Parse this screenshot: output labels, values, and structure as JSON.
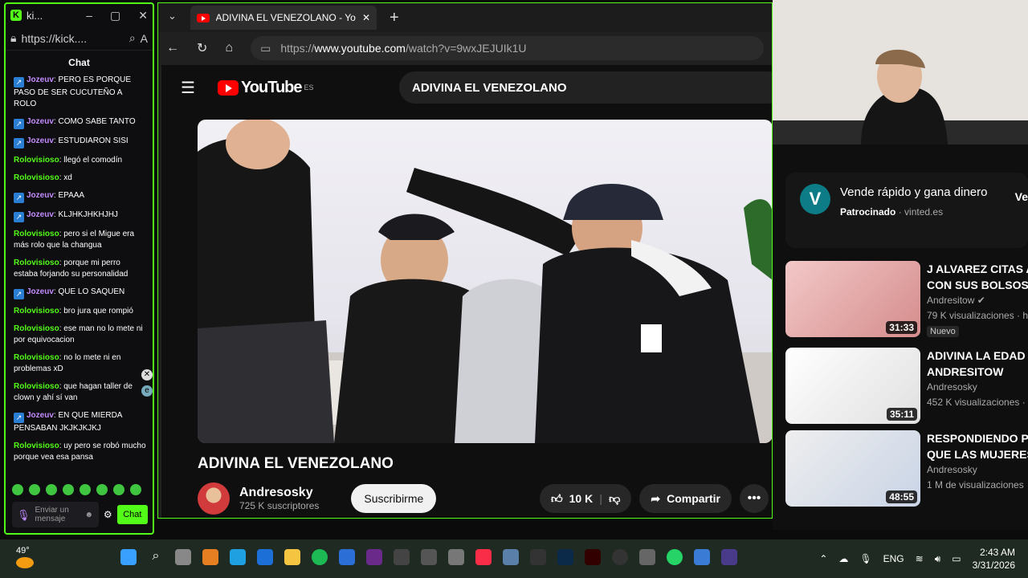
{
  "kick": {
    "tab_title": "ki...",
    "url": "https://kick....",
    "chat_title": "Chat",
    "messages": [
      {
        "user": "Jozeuv",
        "badge": true,
        "text": "PERO ES PORQUE PASO DE SER CUCUTEÑO A ROLO"
      },
      {
        "user": "Jozeuv",
        "badge": true,
        "text": "COMO SABE TANTO"
      },
      {
        "user": "Jozeuv",
        "badge": true,
        "text": "ESTUDIARON SISI"
      },
      {
        "user": "Rolovisioso",
        "badge": false,
        "text": "llegó el comodín"
      },
      {
        "user": "Rolovisioso",
        "badge": false,
        "text": "xd"
      },
      {
        "user": "Jozeuv",
        "badge": true,
        "text": "EPAAA"
      },
      {
        "user": "Jozeuv",
        "badge": true,
        "text": "KLJHKJHKHJHJ"
      },
      {
        "user": "Rolovisioso",
        "badge": false,
        "text": "pero si el Migue era más rolo que la changua"
      },
      {
        "user": "Rolovisioso",
        "badge": false,
        "text": "porque mi perro estaba forjando su personalidad"
      },
      {
        "user": "Jozeuv",
        "badge": true,
        "text": "QUE LO SAQUEN"
      },
      {
        "user": "Rolovisioso",
        "badge": false,
        "text": "bro jura que rompió"
      },
      {
        "user": "Rolovisioso",
        "badge": false,
        "text": "ese man no lo mete ni por equivocacion"
      },
      {
        "user": "Rolovisioso",
        "badge": false,
        "text": "no lo mete ni en problemas xD"
      },
      {
        "user": "Rolovisioso",
        "badge": false,
        "text": "que hagan taller de clown y ahí sí van"
      },
      {
        "user": "Jozeuv",
        "badge": true,
        "text": "EN QUE MIERDA PENSABAN JKJKJKJKJ"
      },
      {
        "user": "Rolovisioso",
        "badge": false,
        "text": "uy pero se robó mucho porque vea esa pansa"
      }
    ],
    "send_placeholder": "Enviar un mensaje",
    "chat_button": "Chat"
  },
  "browser": {
    "tab_title": "ADIVINA EL VENEZOLANO - YouTu",
    "url_prefix": "https://",
    "url_domain": "www.youtube.com",
    "url_path": "/watch?v=9wxJEJUIk1U"
  },
  "youtube": {
    "logo": "YouTube",
    "region": "ES",
    "search_query": "ADIVINA EL VENEZOLANO",
    "video_title": "ADIVINA EL VENEZOLANO",
    "channel": "Andresosky",
    "subscribers": "725 K suscriptores",
    "subscribe": "Suscribirme",
    "likes": "10 K",
    "share": "Compartir",
    "ad": {
      "title": "Vende rápido y gana dinero",
      "sponsored": "Patrocinado",
      "domain": "· vinted.es",
      "cta": "Ve"
    },
    "recommendations": [
      {
        "title1": "J ALVAREZ CITAS A",
        "title2": "CON SUS BOLSOS",
        "channel": "Andresitow",
        "views": "79 K visualizaciones · h",
        "duration": "31:33",
        "badge": "Nuevo"
      },
      {
        "title1": "ADIVINA LA EDAD -",
        "title2": "ANDRESITOW",
        "channel": "Andresosky",
        "views": "452 K visualizaciones ·",
        "duration": "35:11",
        "badge": ""
      },
      {
        "title1": "RESPONDIENDO PR",
        "title2": "QUE LAS MUJERES",
        "channel": "Andresosky",
        "views": "1 M de visualizaciones",
        "duration": "48:55",
        "badge": ""
      }
    ]
  },
  "taskbar": {
    "weather": "49°",
    "lang": "ENG",
    "time": "2:43 AM",
    "date": "3/31/2026"
  }
}
